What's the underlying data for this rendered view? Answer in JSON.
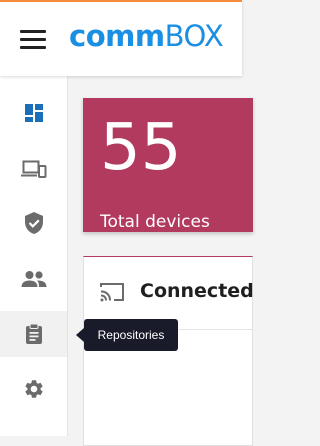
{
  "header": {
    "logo_bold": "comm",
    "logo_light": "BOX",
    "brand_color": "#1a8fe3",
    "accent_line_color": "#f28b3c"
  },
  "sidebar": {
    "items": [
      {
        "icon": "dashboard-icon",
        "active": false
      },
      {
        "icon": "devices-icon",
        "active": false
      },
      {
        "icon": "shield-check-icon",
        "active": false
      },
      {
        "icon": "people-icon",
        "active": false
      },
      {
        "icon": "clipboard-icon",
        "active": true
      },
      {
        "icon": "gear-icon",
        "active": false
      }
    ]
  },
  "tooltip": {
    "text": "Repositories"
  },
  "stats": {
    "total_devices_value": "55",
    "total_devices_label": "Total devices",
    "card_color": "#b23a5e"
  },
  "connected_card": {
    "title": "Connected",
    "icon": "cast-icon"
  }
}
